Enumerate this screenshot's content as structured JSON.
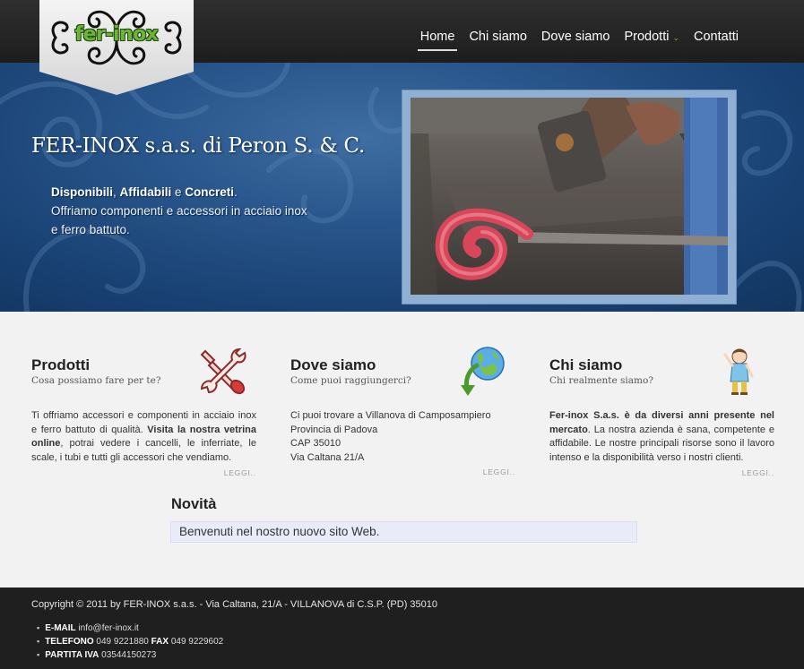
{
  "logo": {
    "text": "fer-inox"
  },
  "nav": {
    "items": [
      {
        "label": "Home"
      },
      {
        "label": "Chi siamo"
      },
      {
        "label": "Dove siamo"
      },
      {
        "label": "Prodotti"
      },
      {
        "label": "Contatti"
      }
    ],
    "dropdown_glyph": "⌄"
  },
  "hero": {
    "title": "FER-INOX s.a.s. di Peron S. & C.",
    "tag_1": "Disponibili",
    "sep_1": ", ",
    "tag_2": "Affidabili",
    "sep_2": " e ",
    "tag_3": "Concreti",
    "sep_3": ".",
    "line_2": "Offriamo componenti e accessori in acciaio inox",
    "line_3": "e ferro battuto."
  },
  "columns": [
    {
      "title": "Prodotti",
      "subtitle": "Cosa possiamo fare per te?",
      "text_1": "Ti offriamo accessori e componenti in acciaio inox e ferro battuto di qualità. ",
      "text_bold": "Visita la nostra vetrina online",
      "text_2": ", potrai vedere i cancelli, le inferriate, le scale, i tubi e tutti gli accessori che vendiamo.",
      "more": "LEGGI.."
    },
    {
      "title": "Dove siamo",
      "subtitle": "Come puoi raggiungerci?",
      "lines": [
        "Ci puoi trovare a Villanova di Camposampiero",
        "Provincia di Padova",
        "CAP 35010",
        "Via Caltana 21/A"
      ],
      "more": "LEGGI.."
    },
    {
      "title": "Chi siamo",
      "subtitle": "Chi realmente siamo?",
      "text_bold": "Fer-inox S.a.s. è da diversi anni presente nel mercato",
      "text_2": ". La nostra azienda è sana, competente e affidabile. Le nostre principali risorse sono il lavoro intenso e la disponibilità verso i nostri clienti.",
      "more": "LEGGI.."
    }
  ],
  "news": {
    "title": "Novità",
    "item": "Benvenuti nel nostro nuovo sito Web."
  },
  "footer": {
    "copyright": "Copyright © 2011 by FER-INOX s.a.s. - Via Caltana, 21/A - VILLANOVA di C.S.P. (PD) 35010",
    "email_label": "E-MAIL",
    "email_value": " info@fer-inox.it",
    "phone_label": "TELEFONO",
    "phone_value": " 049 9221880 ",
    "fax_label": "FAX",
    "fax_value": " 049 9229602",
    "vat_label": "PARTITA IVA",
    "vat_value": " 03544150273"
  },
  "colors": {
    "header_bg": "#262626",
    "hero_blue": "#28558b",
    "accent_green": "#78b63c",
    "footer_bg": "#1f1f1f"
  }
}
